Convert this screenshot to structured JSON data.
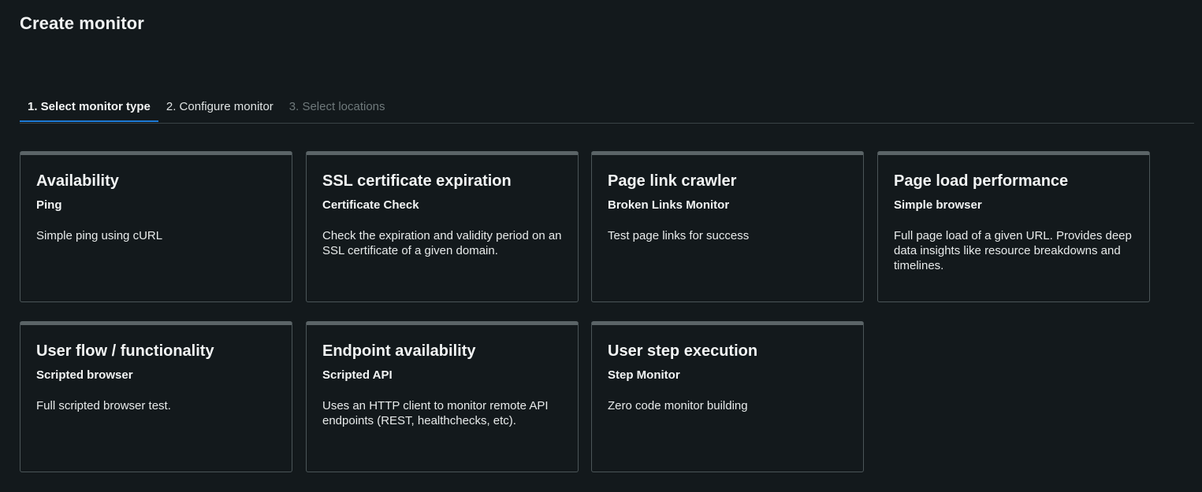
{
  "page": {
    "title": "Create monitor"
  },
  "steps": [
    {
      "label": "1. Select monitor type",
      "state": "active"
    },
    {
      "label": "2. Configure monitor",
      "state": "normal"
    },
    {
      "label": "3. Select locations",
      "state": "disabled"
    }
  ],
  "cards": [
    {
      "title": "Availability",
      "subtitle": "Ping",
      "description": "Simple ping using cURL"
    },
    {
      "title": "SSL certificate expiration",
      "subtitle": "Certificate Check",
      "description": "Check the expiration and validity period on an SSL certificate of a given domain."
    },
    {
      "title": "Page link crawler",
      "subtitle": "Broken Links Monitor",
      "description": "Test page links for success"
    },
    {
      "title": "Page load performance",
      "subtitle": "Simple browser",
      "description": "Full page load of a given URL. Provides deep data insights like resource breakdowns and timelines."
    },
    {
      "title": "User flow / functionality",
      "subtitle": "Scripted browser",
      "description": "Full scripted browser test."
    },
    {
      "title": "Endpoint availability",
      "subtitle": "Scripted API",
      "description": "Uses an HTTP client to monitor remote API endpoints (REST, healthchecks, etc)."
    },
    {
      "title": "User step execution",
      "subtitle": "Step Monitor",
      "description": "Zero code monitor building"
    }
  ],
  "colors": {
    "background": "#13191c",
    "active_tab_underline": "#1d7ad6",
    "card_border": "#4b5558",
    "card_top_border": "#5b6467"
  }
}
